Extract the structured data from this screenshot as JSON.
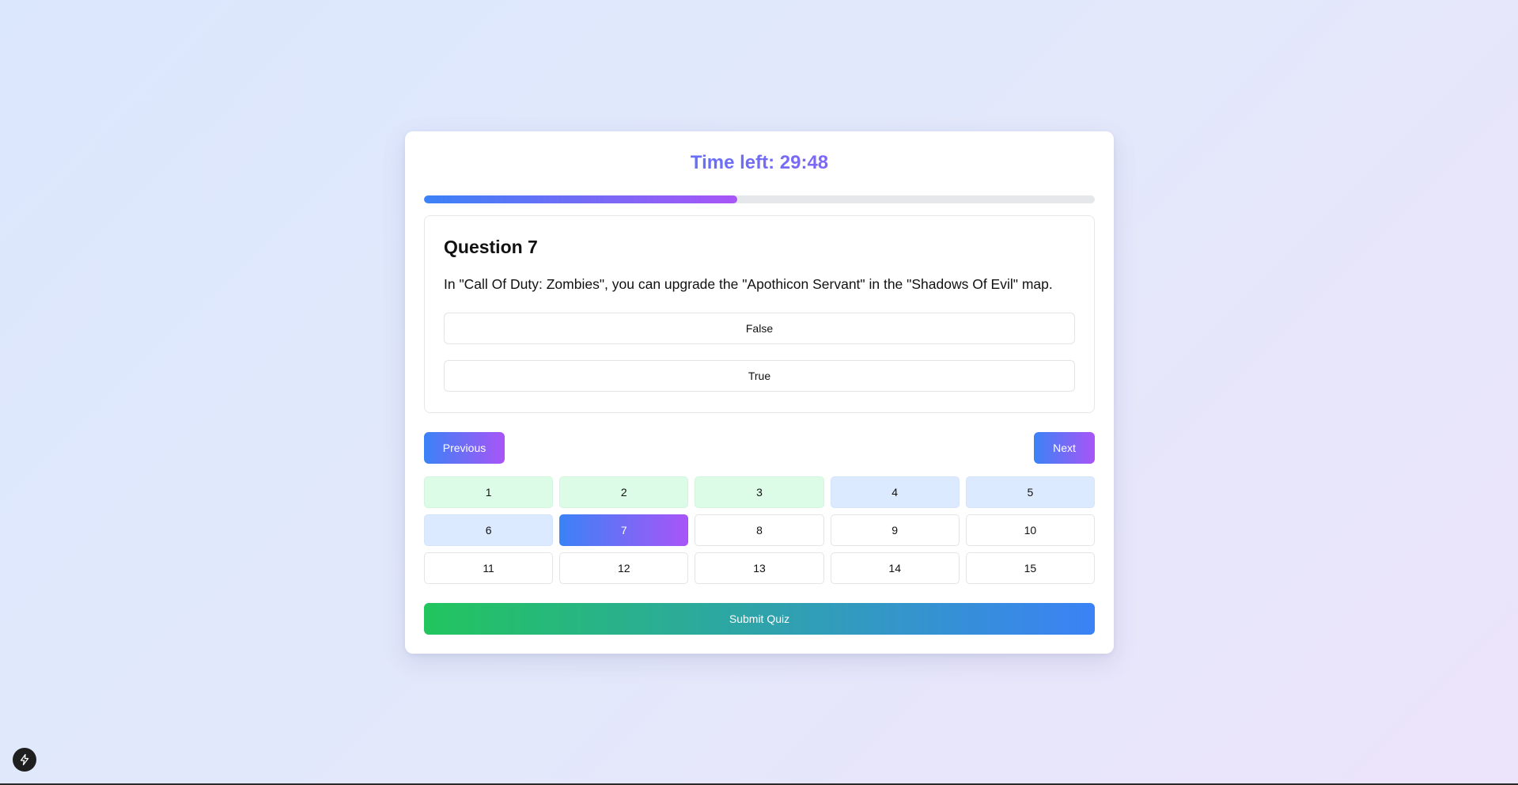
{
  "timer": {
    "label": "Time left:",
    "value": "29:48"
  },
  "progress": {
    "fraction": 0.4667
  },
  "question": {
    "title": "Question 7",
    "text": "In \"Call Of Duty: Zombies\", you can upgrade the \"Apothicon Servant\" in the \"Shadows Of Evil\" map.",
    "answers": [
      "False",
      "True"
    ]
  },
  "navigation": {
    "previous_label": "Previous",
    "next_label": "Next"
  },
  "question_grid": [
    {
      "label": "1",
      "state": "answered"
    },
    {
      "label": "2",
      "state": "answered"
    },
    {
      "label": "3",
      "state": "answered"
    },
    {
      "label": "4",
      "state": "visited"
    },
    {
      "label": "5",
      "state": "visited"
    },
    {
      "label": "6",
      "state": "visited"
    },
    {
      "label": "7",
      "state": "current"
    },
    {
      "label": "8",
      "state": "unvisited"
    },
    {
      "label": "9",
      "state": "unvisited"
    },
    {
      "label": "10",
      "state": "unvisited"
    },
    {
      "label": "11",
      "state": "unvisited"
    },
    {
      "label": "12",
      "state": "unvisited"
    },
    {
      "label": "13",
      "state": "unvisited"
    },
    {
      "label": "14",
      "state": "unvisited"
    },
    {
      "label": "15",
      "state": "unvisited"
    }
  ],
  "submit_label": "Submit Quiz",
  "colors": {
    "accent_start": "#3b82f6",
    "accent_end": "#a855f7",
    "answered_bg": "#dcfce7",
    "visited_bg": "#dbeafe",
    "submit_start": "#22c55e",
    "submit_end": "#3b82f6"
  },
  "corner_badge": {
    "icon": "lightning-bolt-icon"
  }
}
